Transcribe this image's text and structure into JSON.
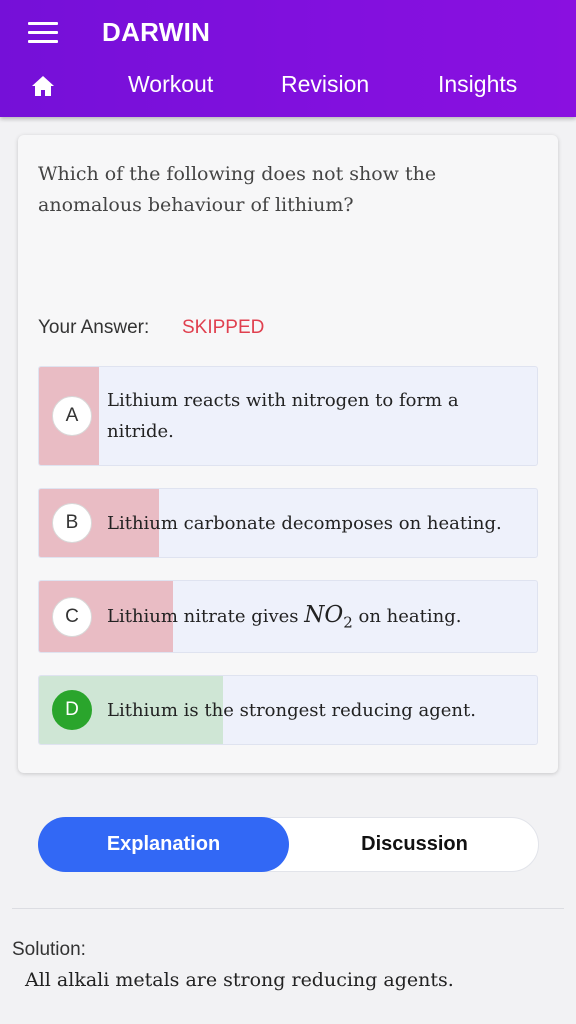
{
  "app": {
    "title": "DARWIN"
  },
  "header": {
    "nav": [
      {
        "icon": "home-icon"
      },
      {
        "label": "Workout"
      },
      {
        "label": "Revision"
      },
      {
        "label": "Insights"
      }
    ]
  },
  "question": {
    "text": "Which of the following does not show the anomalous behaviour of lithium?",
    "answer_label": "Your Answer:",
    "answer_value": "SKIPPED",
    "options": [
      {
        "letter": "A",
        "text": "Lithium reacts with nitrogen to form a nitride.",
        "fill_fraction": 0.12,
        "status": "incorrect"
      },
      {
        "letter": "B",
        "text": "Lithium carbonate decomposes on heating.",
        "fill_fraction": 0.24,
        "status": "incorrect"
      },
      {
        "letter": "C",
        "text_before": "Lithium nitrate gives ",
        "math_base": "NO",
        "math_sub": "2",
        "text_after": " on heating.",
        "fill_fraction": 0.27,
        "status": "incorrect"
      },
      {
        "letter": "D",
        "text": "Lithium is the strongest reducing agent.",
        "fill_fraction": 0.37,
        "status": "correct"
      }
    ]
  },
  "tabs": {
    "explanation": "Explanation",
    "discussion": "Discussion",
    "active": "Explanation"
  },
  "solution": {
    "label": "Solution:",
    "text": "All alkali metals are strong reducing agents."
  },
  "colors": {
    "header": "#8210de",
    "incorrect_fill": "#e9bcc4",
    "correct_fill": "#cfe6d5",
    "accent_blue": "#3268f5",
    "skipped_red": "#e0404f",
    "correct_green": "#2aa52c"
  }
}
